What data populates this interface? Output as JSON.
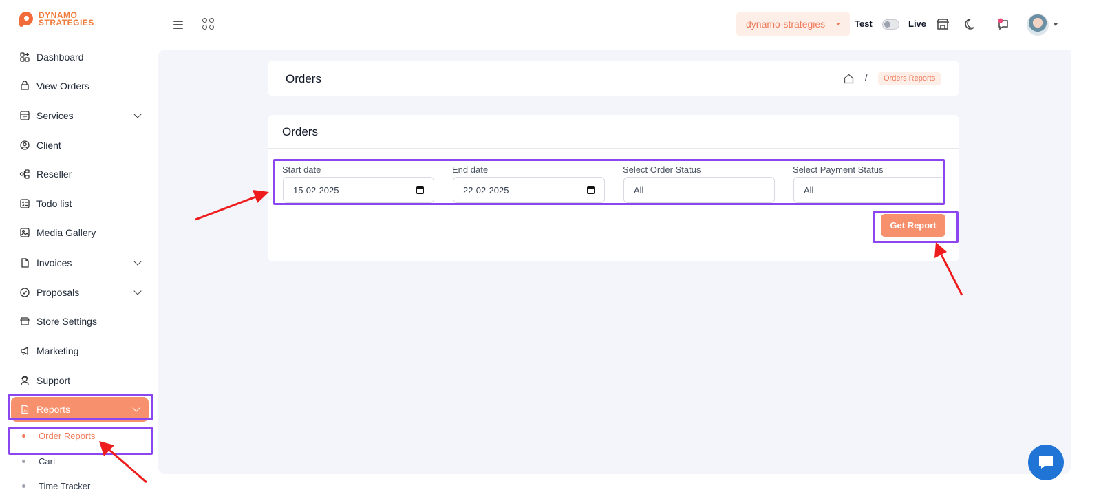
{
  "brand": {
    "line1": "DYNAMO",
    "line2": "STRATEGIES"
  },
  "header": {
    "store_select": "dynamo-strategies",
    "mode_test": "Test",
    "mode_live": "Live"
  },
  "sidebar": {
    "items": [
      {
        "label": "Dashboard",
        "icon": "dashboard-icon"
      },
      {
        "label": "View Orders",
        "icon": "orders-icon"
      },
      {
        "label": "Services",
        "icon": "services-icon"
      },
      {
        "label": "Client",
        "icon": "client-icon"
      },
      {
        "label": "Reseller",
        "icon": "reseller-icon"
      },
      {
        "label": "Todo list",
        "icon": "todo-icon"
      },
      {
        "label": "Media Gallery",
        "icon": "gallery-icon"
      },
      {
        "label": "Invoices",
        "icon": "invoice-icon"
      },
      {
        "label": "Proposals",
        "icon": "proposal-icon"
      },
      {
        "label": "Store Settings",
        "icon": "store-icon"
      },
      {
        "label": "Marketing",
        "icon": "megaphone-icon"
      },
      {
        "label": "Support",
        "icon": "support-icon"
      },
      {
        "label": "Reports",
        "icon": "report-icon"
      }
    ],
    "sub_items": [
      "Order Reports",
      "Cart",
      "Time Tracker"
    ]
  },
  "breadcrumb": {
    "title": "Orders",
    "separator": "/",
    "current": "Orders Reports"
  },
  "form": {
    "title": "Orders",
    "start_label": "Start date",
    "start_value": "15-02-2025",
    "end_label": "End date",
    "end_value": "22-02-2025",
    "order_status_label": "Select Order Status",
    "order_status_value": "All",
    "payment_status_label": "Select Payment Status",
    "payment_status_value": "All",
    "submit": "Get Report"
  },
  "colors": {
    "accent": "#f7906c",
    "highlight": "#8b46f0",
    "arrow": "#ee1c1c",
    "chat": "#1f74d6"
  }
}
